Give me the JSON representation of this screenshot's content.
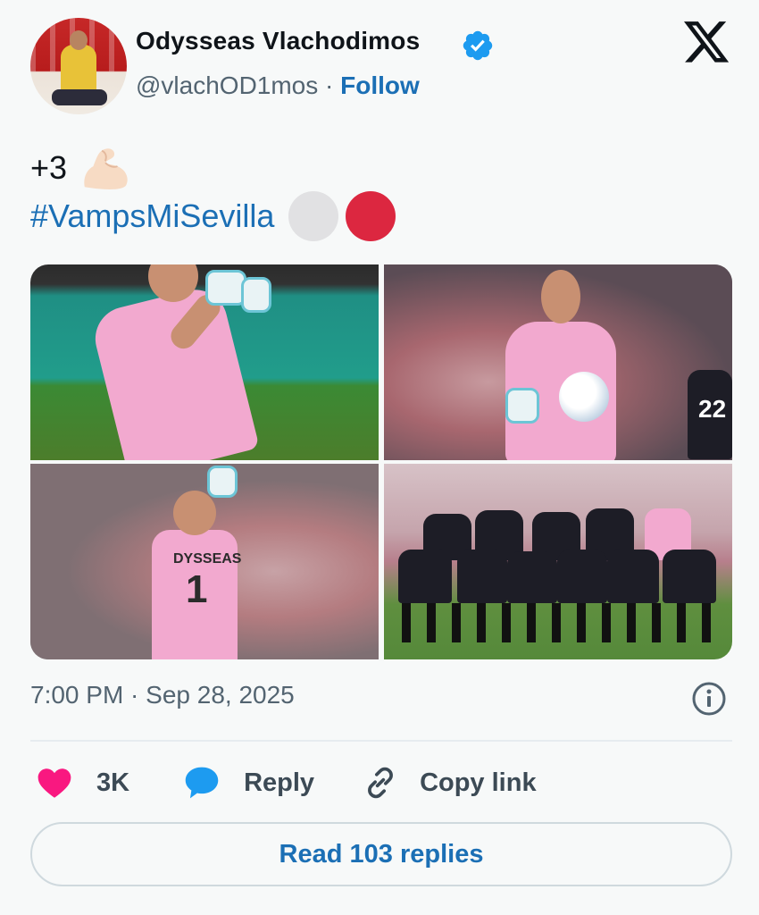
{
  "author": {
    "name": "Odysseas Vlachodimos",
    "handle": "@vlachOD1mos",
    "separator": "·",
    "follow_label": "Follow",
    "avatar_icon": "profile-photo",
    "verified_icon": "verified-badge-icon"
  },
  "brand": {
    "logo": "x-logo-icon"
  },
  "tweet": {
    "line1_text": "+3",
    "line1_emoji": "flexed-biceps-emoji",
    "hashtag": "#VampsMiSevilla",
    "circle_emojis": [
      "white-circle-emoji",
      "red-circle-emoji"
    ],
    "media_count": 4
  },
  "meta": {
    "timestamp": "7:00 PM · Sep 28, 2025",
    "info_icon": "info-icon"
  },
  "actions": {
    "like_count": "3K",
    "reply_label": "Reply",
    "copy_label": "Copy link"
  },
  "read_replies_label": "Read 103 replies",
  "colors": {
    "accent": "#1b6fb5",
    "heart": "#f91880",
    "reply_bubble": "#1d9bf0",
    "verified": "#1d9bf0",
    "muted_text": "#536471"
  }
}
